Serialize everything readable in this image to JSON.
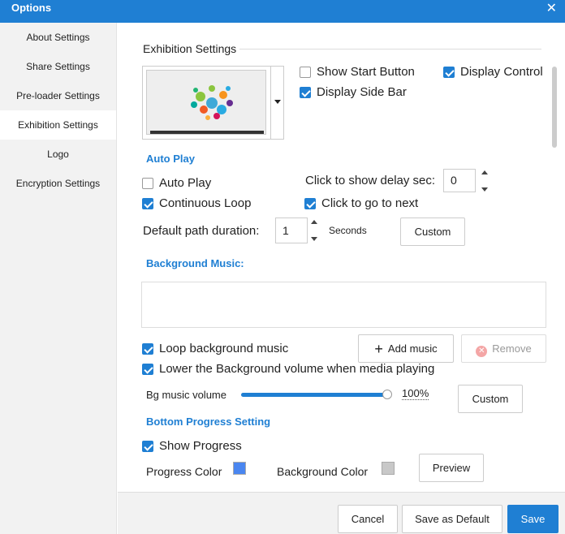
{
  "window": {
    "title": "Options",
    "close_glyph": "✕"
  },
  "sidebar": {
    "items": [
      {
        "label": "About Settings"
      },
      {
        "label": "Share Settings"
      },
      {
        "label": "Pre-loader Settings"
      },
      {
        "label": "Exhibition Settings",
        "active": true
      },
      {
        "label": "Logo"
      },
      {
        "label": "Encryption Settings"
      }
    ]
  },
  "exhibition": {
    "section_title": "Exhibition Settings",
    "show_start_button": {
      "label": "Show Start Button",
      "checked": false
    },
    "display_control": {
      "label": "Display Control",
      "checked": true
    },
    "display_side_bar": {
      "label": "Display Side Bar",
      "checked": true
    }
  },
  "autoplay": {
    "heading": "Auto Play",
    "auto_play": {
      "label": "Auto Play",
      "checked": false
    },
    "continuous_loop": {
      "label": "Continuous Loop",
      "checked": true
    },
    "click_delay_label": "Click to show delay sec:",
    "click_delay_value": "0",
    "click_to_next": {
      "label": "Click to go to next",
      "checked": true
    },
    "path_duration_label": "Default path duration:",
    "path_duration_value": "1",
    "seconds_label": "Seconds",
    "custom_button": "Custom"
  },
  "background_music": {
    "heading": "Background Music:",
    "add_music_button": "Add music",
    "remove_button": "Remove",
    "loop": {
      "label": "Loop background music",
      "checked": true
    },
    "lower_volume": {
      "label": "Lower the Background volume when media playing",
      "checked": true
    },
    "volume_label": "Bg music volume",
    "volume_value": "100%",
    "volume_fraction": 1.0,
    "custom_button": "Custom"
  },
  "progress": {
    "heading": "Bottom Progress Setting",
    "show_progress": {
      "label": "Show Progress",
      "checked": true
    },
    "progress_color_label": "Progress Color",
    "background_color_label": "Background Color",
    "progress_color": "#4a86f0",
    "background_color": "#c8c8c8",
    "preview_button": "Preview"
  },
  "footer": {
    "cancel": "Cancel",
    "save_default": "Save as Default",
    "save": "Save"
  },
  "colors": {
    "accent": "#1f7fd3"
  }
}
